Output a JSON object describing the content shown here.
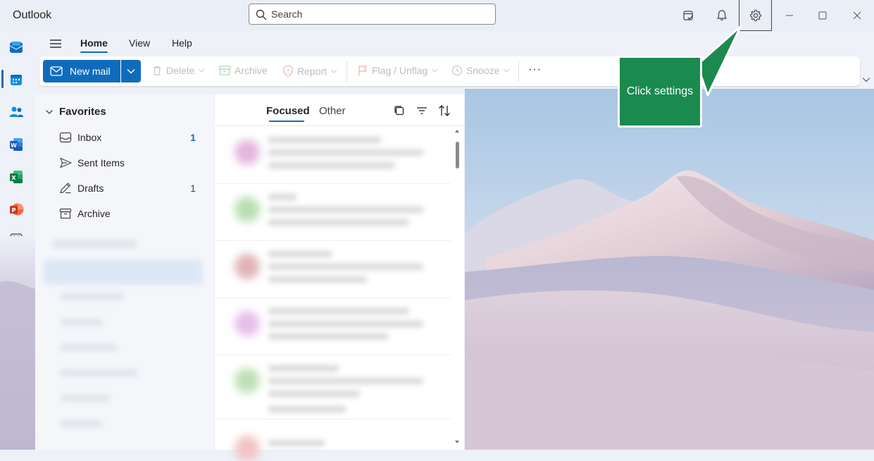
{
  "app": {
    "title": "Outlook"
  },
  "search": {
    "placeholder": "Search"
  },
  "ribbon": {
    "tabs": [
      "Home",
      "View",
      "Help"
    ],
    "new_mail": "New mail",
    "delete": "Delete",
    "archive": "Archive",
    "report": "Report",
    "flag": "Flag / Unflag",
    "snooze": "Snooze",
    "more": "···"
  },
  "folders": {
    "favorites_label": "Favorites",
    "items": [
      {
        "label": "Inbox",
        "count": "1",
        "icon": "inbox-icon"
      },
      {
        "label": "Sent Items",
        "count": "",
        "icon": "send-icon"
      },
      {
        "label": "Drafts",
        "count": "1",
        "icon": "drafts-icon"
      },
      {
        "label": "Archive",
        "count": "",
        "icon": "archive-icon"
      }
    ]
  },
  "mail_list": {
    "focused": "Focused",
    "other": "Other"
  },
  "callout": {
    "text": "Click settings"
  },
  "colors": {
    "accent": "#0f6cbd",
    "callout": "#1a8a4f"
  }
}
